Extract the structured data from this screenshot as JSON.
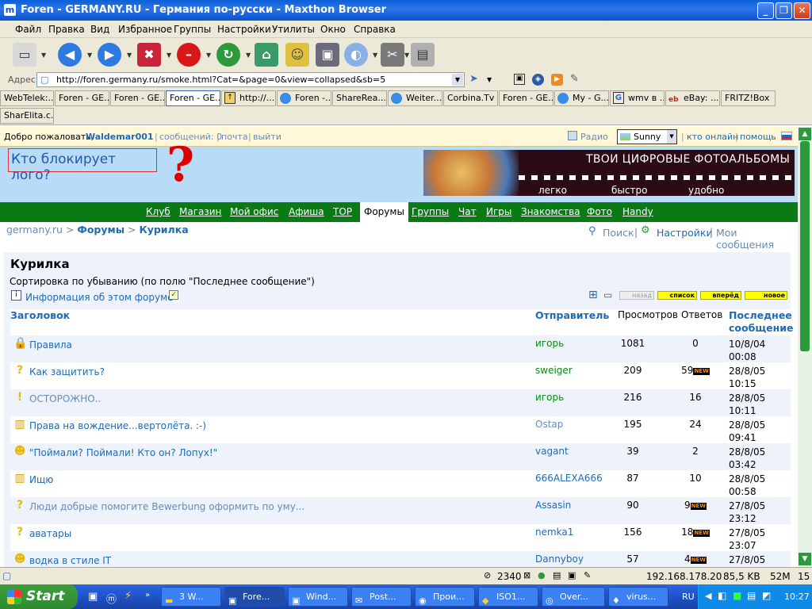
{
  "window": {
    "title": "Foren - GERMANY.RU - Германия по-русски - Maxthon Browser"
  },
  "menu": [
    "Файл",
    "Правка",
    "Вид",
    "Избранное",
    "Группы",
    "Настройки",
    "Утилиты",
    "Окно",
    "Справка"
  ],
  "address": {
    "label": "Адрес",
    "url": "http://foren.germany.ru/smoke.html?Cat=&page=0&view=collapsed&sb=5"
  },
  "tabs": [
    "WebTelek:...",
    "Foren - GE...",
    "Foren - GE...",
    "Foren - GE...",
    "http://...",
    "Foren -...",
    "ShareRea...",
    "Weiter...",
    "Corbina.Tv",
    "Foren - GE...",
    "My - G...",
    "wmv в ...",
    "eBay: ...",
    "FRITZ!Box",
    "SharElita.c..."
  ],
  "welcome": {
    "text": "Добро пожаловать,",
    "user": "Waldemar001",
    "msg": "сообщений: 0",
    "mail": "почта",
    "logout": "выйти",
    "radio": "Радио",
    "skin": "Sunny",
    "online": "кто онлайн",
    "help": "помощь"
  },
  "banner": {
    "logo_text": "Кто блокирует лого?",
    "question": "?",
    "ad_title": "ТВОИ ЦИФРОВЫЕ ФОТОАЛЬБОМЫ",
    "ad_words": [
      "легко",
      "быстро",
      "удобно"
    ]
  },
  "nav": [
    "Клуб",
    "Магазин",
    "Мой офис",
    "Афиша",
    "TOP",
    "Форумы",
    "Группы",
    "Чат",
    "Игры",
    "Знакомства",
    "Фото",
    "Handy"
  ],
  "breadcrumb": {
    "home": "germany.ru",
    "sep": ">",
    "forums": "Форумы",
    "current": "Курилка"
  },
  "tools": {
    "search": "Поиск",
    "settings": "Настройки",
    "my_messages": "Мои сообщения"
  },
  "forum": {
    "title": "Курилка",
    "sort": "Сортировка по убыванию (по полю \"Последнее сообщение\")",
    "info": "Информация об этом форуме",
    "buttons": [
      "назад",
      "список",
      "вперёд",
      "новое"
    ],
    "columns": {
      "title": "Заголовок",
      "author": "Отправитель",
      "views": "Просмотров",
      "replies": "Ответов",
      "last1": "Последнее",
      "last2": "сообщение"
    },
    "rows": [
      {
        "icon": "lock-icon",
        "title": "Правила",
        "author": "игорь",
        "views": "1081",
        "replies": "0",
        "new": false,
        "d": "10/8/04",
        "t": "00:08"
      },
      {
        "icon": "question-icon",
        "title": "Как защитить?",
        "author": "sweiger",
        "views": "209",
        "replies": "59",
        "new": true,
        "d": "28/8/05",
        "t": "10:15"
      },
      {
        "icon": "exclamation-icon",
        "title": "ОСТОРОЖНО..",
        "author": "игорь",
        "views": "216",
        "replies": "16",
        "new": false,
        "d": "28/8/05",
        "t": "10:11"
      },
      {
        "icon": "book-icon",
        "title": "Права на вождение...вертолёта. :-)",
        "author": "Ostap",
        "views": "195",
        "replies": "24",
        "new": false,
        "d": "28/8/05",
        "t": "09:41"
      },
      {
        "icon": "smiley-icon",
        "title": "\"Поймали? Поймали! Кто он? Лопух!\"",
        "author": "vagant",
        "views": "39",
        "replies": "2",
        "new": false,
        "d": "28/8/05",
        "t": "03:42"
      },
      {
        "icon": "book-icon",
        "title": "Ищю",
        "author": "666ALEXA666",
        "views": "87",
        "replies": "10",
        "new": false,
        "d": "28/8/05",
        "t": "00:58"
      },
      {
        "icon": "question-icon",
        "title": "Люди добрые помогите Bewerbung оформить по уму...",
        "author": "Assasin",
        "views": "90",
        "replies": "9",
        "new": true,
        "d": "27/8/05",
        "t": "23:12"
      },
      {
        "icon": "question-icon",
        "title": "аватары",
        "author": "nemka1",
        "views": "156",
        "replies": "18",
        "new": true,
        "d": "27/8/05",
        "t": "23:07"
      },
      {
        "icon": "smiley-icon",
        "title": "водка в стиле IT",
        "author": "Dannyboy",
        "views": "57",
        "replies": "4",
        "new": true,
        "d": "27/8/05",
        "t": ""
      }
    ]
  },
  "status": {
    "count": "2340",
    "ip": "192.168.178.20",
    "size": "85,5 KB",
    "mem": "52M",
    "num": "15"
  },
  "taskbar": {
    "start": "Start",
    "tasks": [
      "3 W...",
      "Fore...",
      "Wind...",
      "Post...",
      "Прои...",
      "ISO1...",
      "Over...",
      "virus..."
    ],
    "lang": "RU",
    "clock": "10:27"
  }
}
